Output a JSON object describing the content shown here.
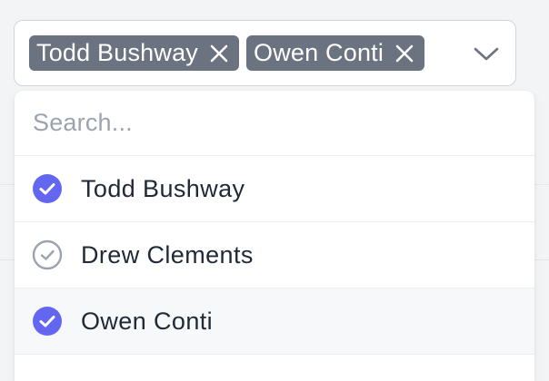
{
  "select": {
    "selected_chips": [
      {
        "label": "Todd Bushway"
      },
      {
        "label": "Owen Conti"
      }
    ]
  },
  "dropdown": {
    "search_placeholder": "Search...",
    "search_value": "",
    "options": [
      {
        "label": "Todd Bushway",
        "selected": true
      },
      {
        "label": "Drew Clements",
        "selected": false
      },
      {
        "label": "Owen Conti",
        "selected": true
      }
    ]
  },
  "colors": {
    "chip_background": "#6b7280",
    "checked_icon": "#6366f1",
    "unchecked_icon": "#9ca3af"
  }
}
